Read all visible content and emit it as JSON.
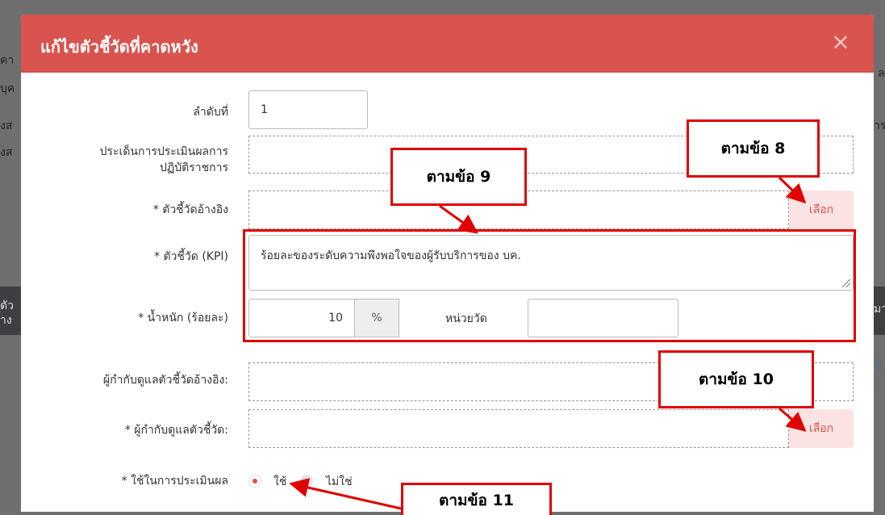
{
  "modal": {
    "title": "แก้ไขตัวชี้วัดที่คาดหวัง",
    "close_label": "×"
  },
  "form": {
    "order_label": "ลำดับที่",
    "order_value": "1",
    "issue_label_1": "ประเด็นการประเมินผลการ",
    "issue_label_2": "ปฏิบัติราชการ",
    "ref_kpi_label": "* ตัวชี้วัดอ้างอิง",
    "select_label": "เลือก",
    "kpi_label": "* ตัวชี้วัด (KPI)",
    "kpi_value": "ร้อยละของระดับความพึงพอใจของผู้รับบริการของ บค.",
    "weight_label": "* น้ำหนัก (ร้อยละ)",
    "weight_value": "10",
    "weight_unit": "%",
    "unit_label": "หน่วยวัด",
    "unit_value": "",
    "ref_supervisor_label": "ผู้กำกับดูแลตัวชี้วัดอ้างอิง:",
    "supervisor_label": "* ผู้กำกับดูแลตัวชี้วัด:",
    "use_in_eval_label": "* ใช้ในการประเมินผล",
    "option_yes": "ใช้",
    "option_no": "ไม่ใช่"
  },
  "callouts": {
    "item8": "ตามข้อ 8",
    "item9": "ตามข้อ 9",
    "item10": "ตามข้อ 10",
    "item11": "ตามข้อ 11"
  },
  "background": {
    "frag1": "คา",
    "frag2": "บุค",
    "frag3": "งส",
    "frag4": "งส",
    "frag5": "ตัว",
    "frag6": "้าง",
    "right1": "ล",
    "right2": "าร",
    "right3": "มา",
    "right4": "5"
  },
  "colors": {
    "header": "#d9534f",
    "callout_border": "#e00000",
    "select_bg": "#fbe3e3"
  }
}
